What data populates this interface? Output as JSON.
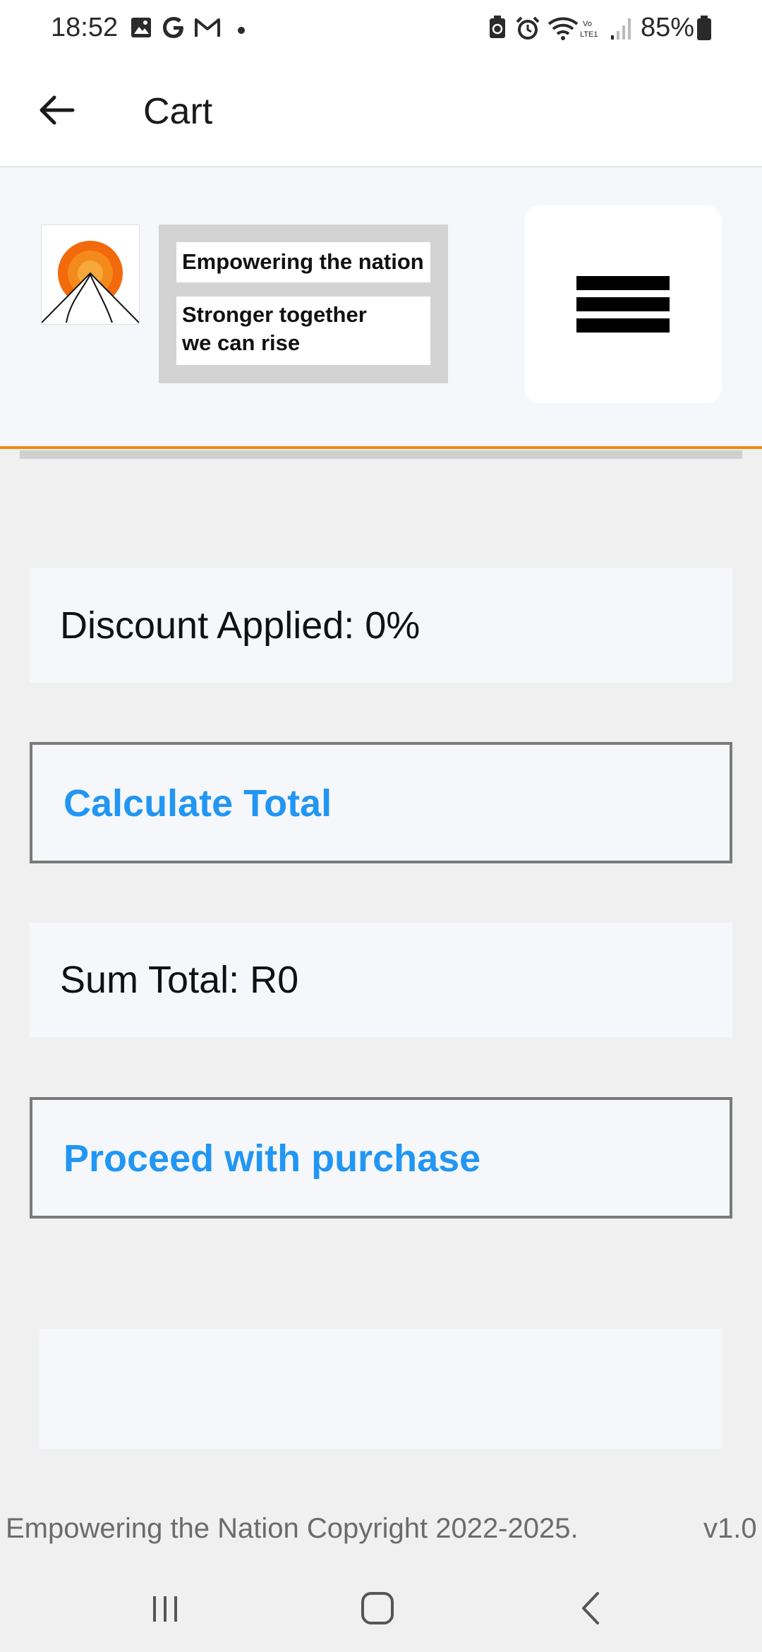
{
  "status_bar": {
    "time": "18:52",
    "battery": "85%",
    "icons": [
      "gallery-icon",
      "google-icon",
      "gmail-icon",
      "dot-icon",
      "battery-saver-icon",
      "alarm-icon",
      "wifi-icon",
      "volte-icon",
      "signal-icon",
      "battery-icon"
    ]
  },
  "app_bar": {
    "title": "Cart",
    "back_icon": "arrow-left-icon"
  },
  "banner": {
    "motto_line1": "Empowering the nation",
    "motto_line2": "Stronger together\nwe can rise",
    "menu_icon": "hamburger-menu-icon",
    "accent_color": "#ef8a14"
  },
  "cart": {
    "discount_text": "Discount Applied: 0%",
    "calculate_label": "Calculate Total",
    "sum_text": "Sum Total: R0",
    "proceed_label": "Proceed with purchase",
    "button_text_color": "#2196f3"
  },
  "footer": {
    "copyright": "Empowering the Nation Copyright 2022-2025.",
    "version": "v1.0"
  },
  "nav_bar": {
    "icons": [
      "recents-icon",
      "home-icon",
      "back-icon"
    ]
  }
}
